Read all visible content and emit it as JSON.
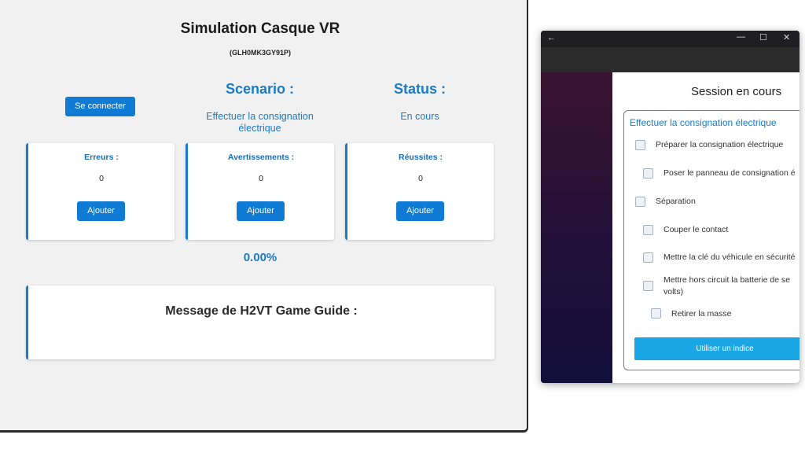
{
  "web": {
    "title": "Simulation Casque VR",
    "session_id": "(GLH0MK3GY91P)",
    "connect_label": "Se connecter",
    "scenario": {
      "title": "Scenario :",
      "value": "Effectuer la consignation électrique"
    },
    "status": {
      "title": "Status :",
      "value": "En cours"
    },
    "cards": [
      {
        "label": "Erreurs :",
        "value": "0",
        "button": "Ajouter"
      },
      {
        "label": "Avertissements :",
        "value": "0",
        "button": "Ajouter"
      },
      {
        "label": "Réussites :",
        "value": "0",
        "button": "Ajouter"
      }
    ],
    "progress": "0.00%",
    "message_title": "Message de H2VT Game Guide :"
  },
  "app": {
    "back_icon": "←",
    "minimize_icon": "—",
    "maximize_icon": "☐",
    "close_icon": "✕",
    "session_title": "Session en cours",
    "task_heading": "Effectuer la consignation électrique",
    "tasks": [
      "Préparer la consignation électrique",
      "Poser le panneau de consignation é",
      "Séparation",
      "Couper le contact",
      "Mettre la clé du véhicule en sécurité",
      "Mettre hors circuit la batterie de se",
      "volts)",
      "Retirer la masse"
    ],
    "hint_button": "Utiliser un indice"
  }
}
